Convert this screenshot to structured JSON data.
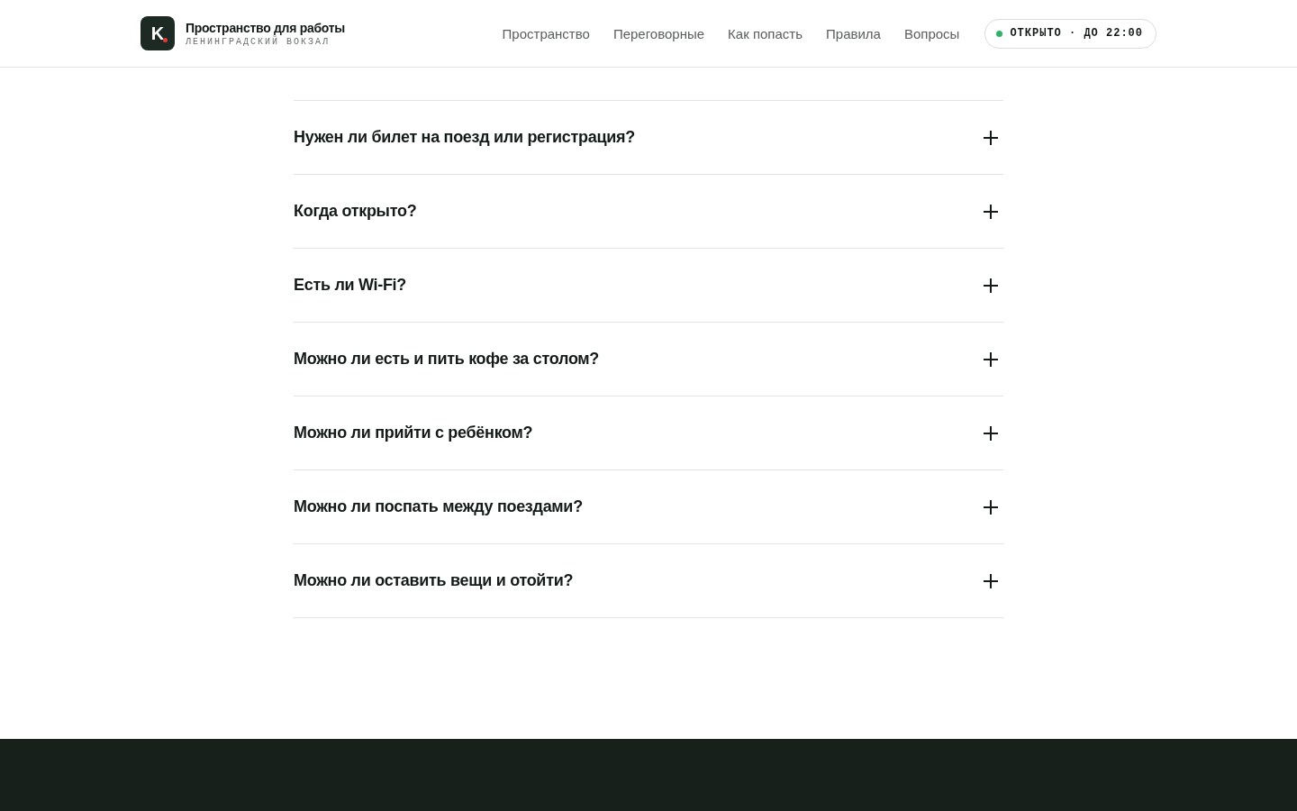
{
  "header": {
    "logo_letter": "K",
    "title": "Пространство для работы",
    "subtitle": "ЛЕНИНГРАДСКИЙ ВОКЗАЛ",
    "nav": [
      {
        "label": "Пространство"
      },
      {
        "label": "Переговорные"
      },
      {
        "label": "Как попасть"
      },
      {
        "label": "Правила"
      },
      {
        "label": "Вопросы"
      }
    ],
    "status": {
      "text": "ОТКРЫТО · ДО 22:00",
      "color": "#2fb36a"
    }
  },
  "faq": [
    {
      "question": "Нужен ли билет на поезд или регистрация?",
      "expanded": false
    },
    {
      "question": "Когда открыто?",
      "expanded": false
    },
    {
      "question": "Есть ли Wi-Fi?",
      "expanded": false
    },
    {
      "question": "Можно ли есть и пить кофе за столом?",
      "expanded": false
    },
    {
      "question": "Можно ли прийти с ребёнком?",
      "expanded": false
    },
    {
      "question": "Можно ли поспать между поездами?",
      "expanded": false
    },
    {
      "question": "Можно ли оставить вещи и отойти?",
      "expanded": false
    }
  ]
}
